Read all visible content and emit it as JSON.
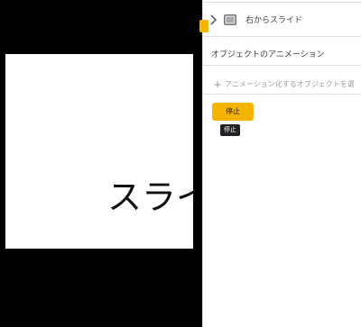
{
  "slide": {
    "text": "スライ"
  },
  "panel": {
    "animation_item": {
      "label": "右からスライド"
    },
    "section_title": "オブジェクトのアニメーション",
    "add_animation_label": "アニメーション化するオブジェクトを選",
    "stop_button_label": "停止",
    "tooltip_text": "停止"
  },
  "colors": {
    "accent": "#f4b400",
    "tooltip_bg": "#202124",
    "canvas_bg": "#000000"
  },
  "icons": [
    "chevron-right-icon",
    "slide-icon",
    "plus-icon"
  ]
}
